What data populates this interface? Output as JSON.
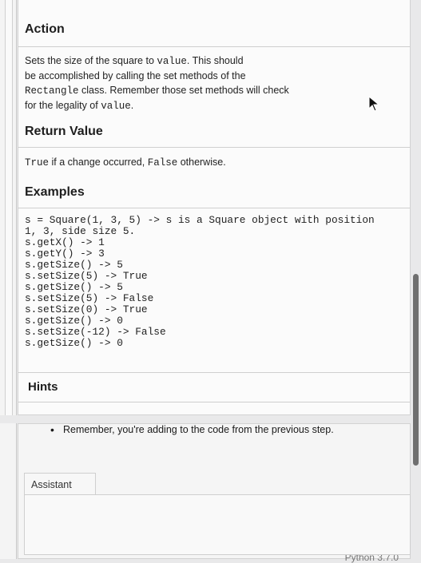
{
  "action": {
    "heading": "Action",
    "desc_1": "Sets the size of the square to ",
    "desc_code_1": "value",
    "desc_2": ". This should",
    "desc_line2": "be accomplished by calling the set methods of the",
    "desc_code_2": "Rectangle",
    "desc_3": " class. Remember those set methods will check",
    "desc_4": "for the legality of ",
    "desc_code_3": "value",
    "desc_5": "."
  },
  "return_value": {
    "heading": "Return Value",
    "code_true": "True",
    "text_mid": " if a change occurred, ",
    "code_false": "False",
    "text_end": " otherwise."
  },
  "examples": {
    "heading": "Examples",
    "code": "s = Square(1, 3, 5) -> s is a Square object with position\n1, 3, side size 5.\ns.getX() -> 1\ns.getY() -> 3\ns.getSize() -> 5\ns.setSize(5) -> True\ns.getSize() -> 5\ns.setSize(5) -> False\ns.setSize(0) -> True\ns.getSize() -> 0\ns.setSize(-12) -> False\ns.getSize() -> 0"
  },
  "hints": {
    "heading": "Hints",
    "items": [
      "Remember, you're adding to the code from the previous step."
    ]
  },
  "assistant": {
    "tab_label": "Assistant"
  },
  "footer": {
    "label": "Python 3.7.0"
  }
}
